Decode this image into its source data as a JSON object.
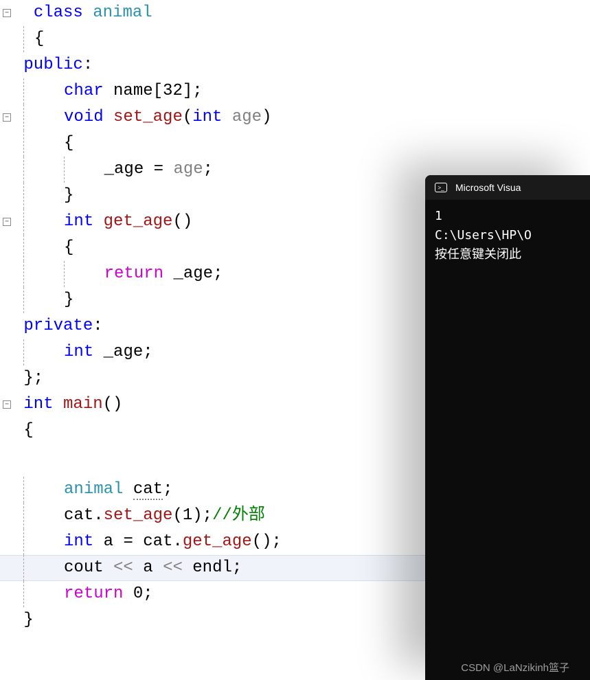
{
  "code": {
    "line1": {
      "class": "class",
      "space": " ",
      "animal": "animal"
    },
    "line2": {
      "brace": "{"
    },
    "line3": {
      "public": "public",
      "colon": ":"
    },
    "line4": {
      "char": "char",
      "name": " name",
      "bracket": "[",
      "num": "32",
      "close": "];"
    },
    "line5": {
      "void": "void",
      "func": " set_age",
      "paren": "(",
      "int": "int",
      "arg": " age",
      "close": ")"
    },
    "line6": {
      "brace": "{"
    },
    "line7": {
      "age1": "_age ",
      "eq": "= ",
      "age2": "age",
      "semi": ";"
    },
    "line8": {
      "brace": "}"
    },
    "line9": {
      "int": "int",
      "func": " get_age",
      "parens": "()"
    },
    "line10": {
      "brace": "{"
    },
    "line11": {
      "return": "return",
      "space": " ",
      "age": "_age;"
    },
    "line12": {
      "brace": "}"
    },
    "line13": {
      "private": "private",
      "colon": ":"
    },
    "line14": {
      "int": "int",
      "age": " _age;"
    },
    "line15": {
      "close": "};"
    },
    "line16": {
      "int": "int",
      "main": " main",
      "parens": "()"
    },
    "line17": {
      "brace": "{"
    },
    "line18": {
      "animal": "animal ",
      "cat": "cat",
      "semi": ";"
    },
    "line19": {
      "cat": "cat",
      "dot": ".",
      "func": "set_age",
      "paren": "(",
      "num": "1",
      "close": ");",
      "comment": "//外部"
    },
    "line20": {
      "int": "int",
      "a": " a ",
      "eq": "= ",
      "cat": "cat",
      "dot": ".",
      "func": "get_age",
      "parens": "();"
    },
    "line21": {
      "cout": "cout ",
      "op1": "<< ",
      "a": "a ",
      "op2": "<< ",
      "endl": "endl;"
    },
    "line22": {
      "return": "return",
      "space": " ",
      "num": "0",
      "semi": ";"
    },
    "line23": {
      "brace": "}"
    }
  },
  "console": {
    "title": "Microsoft Visua",
    "output1": "1",
    "output2": "",
    "output3": "C:\\Users\\HP\\O",
    "output4": "按任意键关闭此"
  },
  "watermark": "CSDN @LaNzikinh篮子"
}
